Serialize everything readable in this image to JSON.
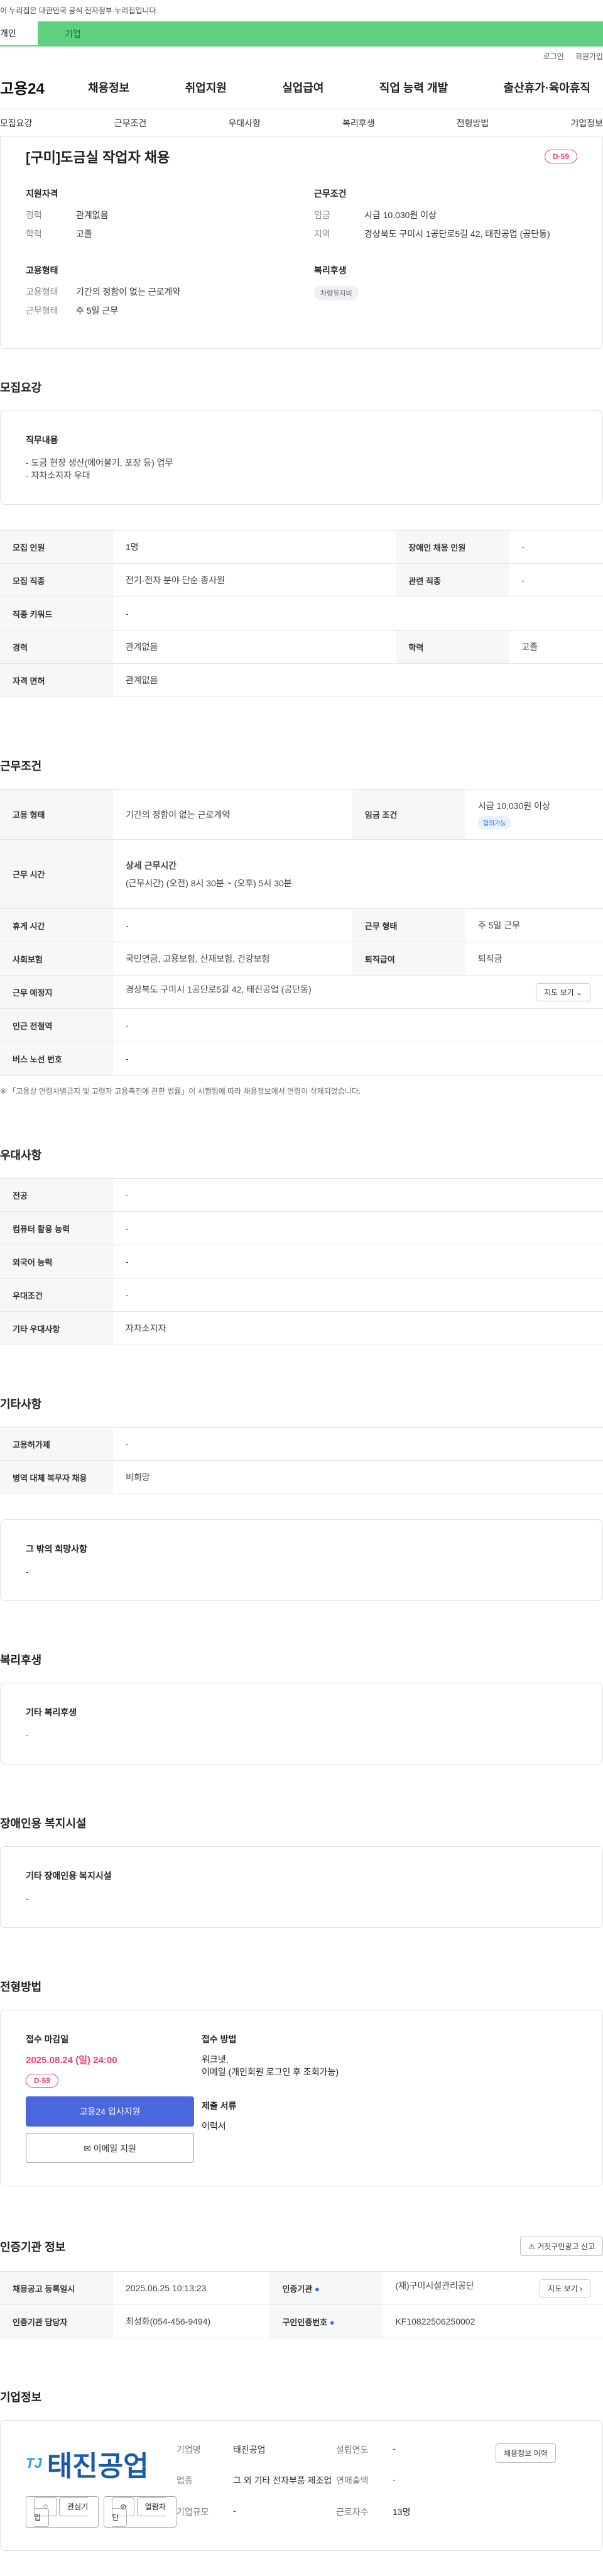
{
  "notice": "이 누리집은 대한민국 공식 전자정부 누리집입니다.",
  "user_tabs": {
    "personal": "개인",
    "company": "기업"
  },
  "util": {
    "login": "로그인",
    "join": "회원가입"
  },
  "logo": "고용24",
  "gnb": [
    "채용정보",
    "취업지원",
    "실업급여",
    "직업 능력 개발",
    "출산휴가·육아휴직"
  ],
  "subnav": [
    "모집요강",
    "근무조건",
    "우대사항",
    "복리후생",
    "전형방법",
    "기업정보"
  ],
  "summary": {
    "title": "[구미]도금실 작업자 채용",
    "dday": "D-59",
    "qual": {
      "heading": "지원자격",
      "rows": [
        {
          "k": "경력",
          "v": "관계없음"
        },
        {
          "k": "학력",
          "v": "고졸"
        }
      ]
    },
    "cond": {
      "heading": "근무조건",
      "rows": [
        {
          "k": "임금",
          "v": "시급 10,030원 이상"
        },
        {
          "k": "지역",
          "v": "경상북도 구미시 1공단로5길 42, 태진공업 (공단동)"
        }
      ]
    },
    "emp": {
      "heading": "고용형태",
      "rows": [
        {
          "k": "고용형태",
          "v": "기간의 정함이 없는 근로계약"
        },
        {
          "k": "근무형태",
          "v": "주 5일 근무"
        }
      ]
    },
    "welfare": {
      "heading": "복리후생",
      "chip": "차량유지비"
    }
  },
  "recruit": {
    "heading": "모집요강",
    "job_title": "직무내용",
    "job_lines": [
      "- 도금 현장 생산(에어불기, 포장 등) 업무",
      "- 자차소지자 우대"
    ],
    "rows": [
      [
        "모집 인원",
        "1명",
        "장애인 채용 인원",
        "-"
      ],
      [
        "모집 직종",
        "전기·전자 분야 단순 종사원",
        "관련 직종",
        "-"
      ],
      [
        "직종 키워드",
        "-"
      ],
      [
        "경력",
        "관계없음",
        "학력",
        "고졸"
      ],
      [
        "자격 면허",
        "관계없음"
      ]
    ]
  },
  "work": {
    "heading": "근무조건",
    "emp_type_label": "고용 형태",
    "emp_type": "기간의 정함이 없는 근로계약",
    "wage_label": "임금 조건",
    "wage": "시급 10,030원 이상",
    "wage_chip": "협의가능",
    "hours_label": "근무 시간",
    "hours_title": "상세 근무시간",
    "hours": "(근무시간) (오전) 8시 30분 ~ (오후) 5시 30분",
    "holiday_label": "휴게 시간",
    "holiday": "-",
    "worktype_label": "근무 형태",
    "worktype": "주 5일 근무",
    "insurance_label": "사회보험",
    "insurance": "국민연금, 고용보험, 산재보험, 건강보험",
    "severance_label": "퇴직급여",
    "severance": "퇴직금",
    "place_label": "근무 예정지",
    "place": "경상북도 구미시 1공단로5길 42, 태진공업 (공단동)",
    "map_btn": "지도 보기",
    "subway_label": "인근 전철역",
    "subway": "-",
    "bus_label": "버스 노선 번호",
    "bus": "-",
    "footnote": "※ 「고용상 연령차별금지 및 고령자 고용촉진에 관한 법률」이 시행됨에 따라 채용정보에서 연령이 삭제되었습니다."
  },
  "pref": {
    "heading": "우대사항",
    "rows": [
      [
        "전공",
        "-"
      ],
      [
        "컴퓨터 활용 능력",
        "-"
      ],
      [
        "외국어 능력",
        "-"
      ],
      [
        "우대조건",
        "-"
      ],
      [
        "기타 우대사항",
        "자차소지자"
      ]
    ]
  },
  "etc": {
    "heading": "기타사항",
    "rows": [
      [
        "고용허가제",
        "-"
      ],
      [
        "병역 대체 복무자 채용",
        "비희망"
      ]
    ],
    "box_title": "그 밖의 희망사항",
    "box_value": "-"
  },
  "benefit": {
    "heading": "복리후생",
    "box_title": "기타 복리후생",
    "box_value": "-"
  },
  "disabled": {
    "heading": "장애인용 복지시설",
    "box_title": "기타 장애인용 복지시설",
    "box_value": "-"
  },
  "process": {
    "heading": "전형방법",
    "deadline_title": "접수 마감일",
    "deadline": "2025.08.24 (일) 24:00",
    "dday": "D-59",
    "apply_btn": "고용24 입사지원",
    "email_btn": "이메일 지원",
    "method_title": "접수 방법",
    "method_lines": [
      "워크넷,",
      "이메일 (개인회원 로그인 후 조회가능)"
    ],
    "docs_title": "제출 서류",
    "docs": "이력서"
  },
  "agency": {
    "heading": "인증기관 정보",
    "report_btn": "거짓구인광고 신고",
    "rows": [
      [
        "채용공고 등록일시",
        "2025.06.25 10:13:23",
        "인증기관",
        "(재)구미시설관리공단"
      ],
      [
        "인증기관 담당자",
        "최성화(054-456-9494)",
        "구인인증번호",
        "KF10822506250002"
      ]
    ],
    "map_btn": "지도 보기"
  },
  "company": {
    "heading": "기업정보",
    "logo_text": "태진공업",
    "logo_mark": "TJ",
    "fav_btn": "관심기업",
    "block_btn": "열람차단",
    "history_btn": "채용정보 이력",
    "rows": [
      [
        "기업명",
        "태진공업",
        "설립연도",
        "-"
      ],
      [
        "업종",
        "그 외 기타 전자부품 제조업",
        "연매출액",
        "-"
      ],
      [
        "기업규모",
        "-",
        "근로자수",
        "13명"
      ]
    ]
  }
}
